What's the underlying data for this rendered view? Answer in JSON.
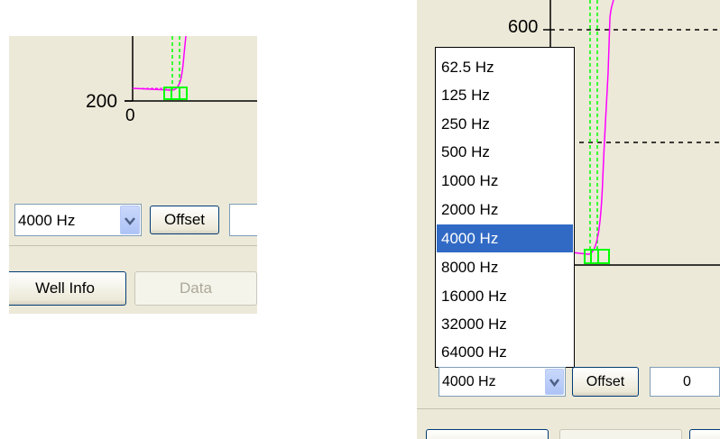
{
  "left_panel": {
    "y_tick_label": "200",
    "x_tick_label": "0",
    "frequency_combo_value": "4000 Hz",
    "offset_button": "Offset",
    "well_info_button": "Well Info",
    "data_button": "Data"
  },
  "right_panel": {
    "y_tick_label": "600",
    "frequency_combo_value": "4000 Hz",
    "offset_button": "Offset",
    "offset_value": "0",
    "dropdown": {
      "selected": "4000 Hz",
      "options": [
        "62.5 Hz",
        "125 Hz",
        "250 Hz",
        "500 Hz",
        "1000 Hz",
        "2000 Hz",
        "4000 Hz",
        "8000 Hz",
        "16000 Hz",
        "32000 Hz",
        "64000 Hz"
      ]
    }
  },
  "colors": {
    "trace": "#ff00ff",
    "marker": "#00ff00",
    "selection": "#316ac5",
    "panel": "#ece9d8"
  }
}
